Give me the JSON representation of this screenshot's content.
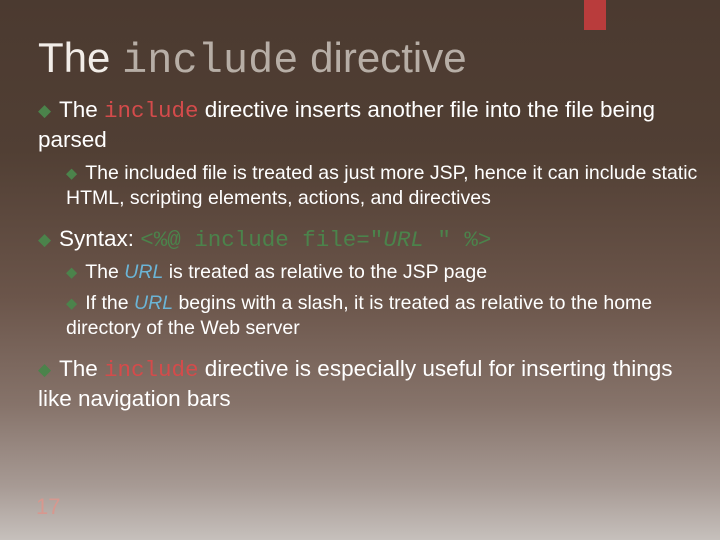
{
  "title": {
    "t1": "The ",
    "kw": "include",
    "t2": " directive"
  },
  "b1": {
    "t1": "The ",
    "kw": "include",
    "t2": " directive inserts another file into the file being parsed"
  },
  "b1a": {
    "t": "The included file is treated as just more JSP, hence it can include static HTML, scripting elements, actions, and directives"
  },
  "b2": {
    "t1": "Syntax:  ",
    "g1": "<%@ include file=\"",
    "u": "URL",
    "g2": " \" %>"
  },
  "b2a": {
    "t1": "The ",
    "it": "URL",
    "t2": " is treated as relative to the JSP page"
  },
  "b2b": {
    "t1": "If the ",
    "it": "URL",
    "t2": " begins with a slash, it is treated as relative to the home directory of the Web server"
  },
  "b3": {
    "t1": "The ",
    "kw": "include",
    "t2": " directive is especially useful for inserting things like navigation bars"
  },
  "page": "17"
}
